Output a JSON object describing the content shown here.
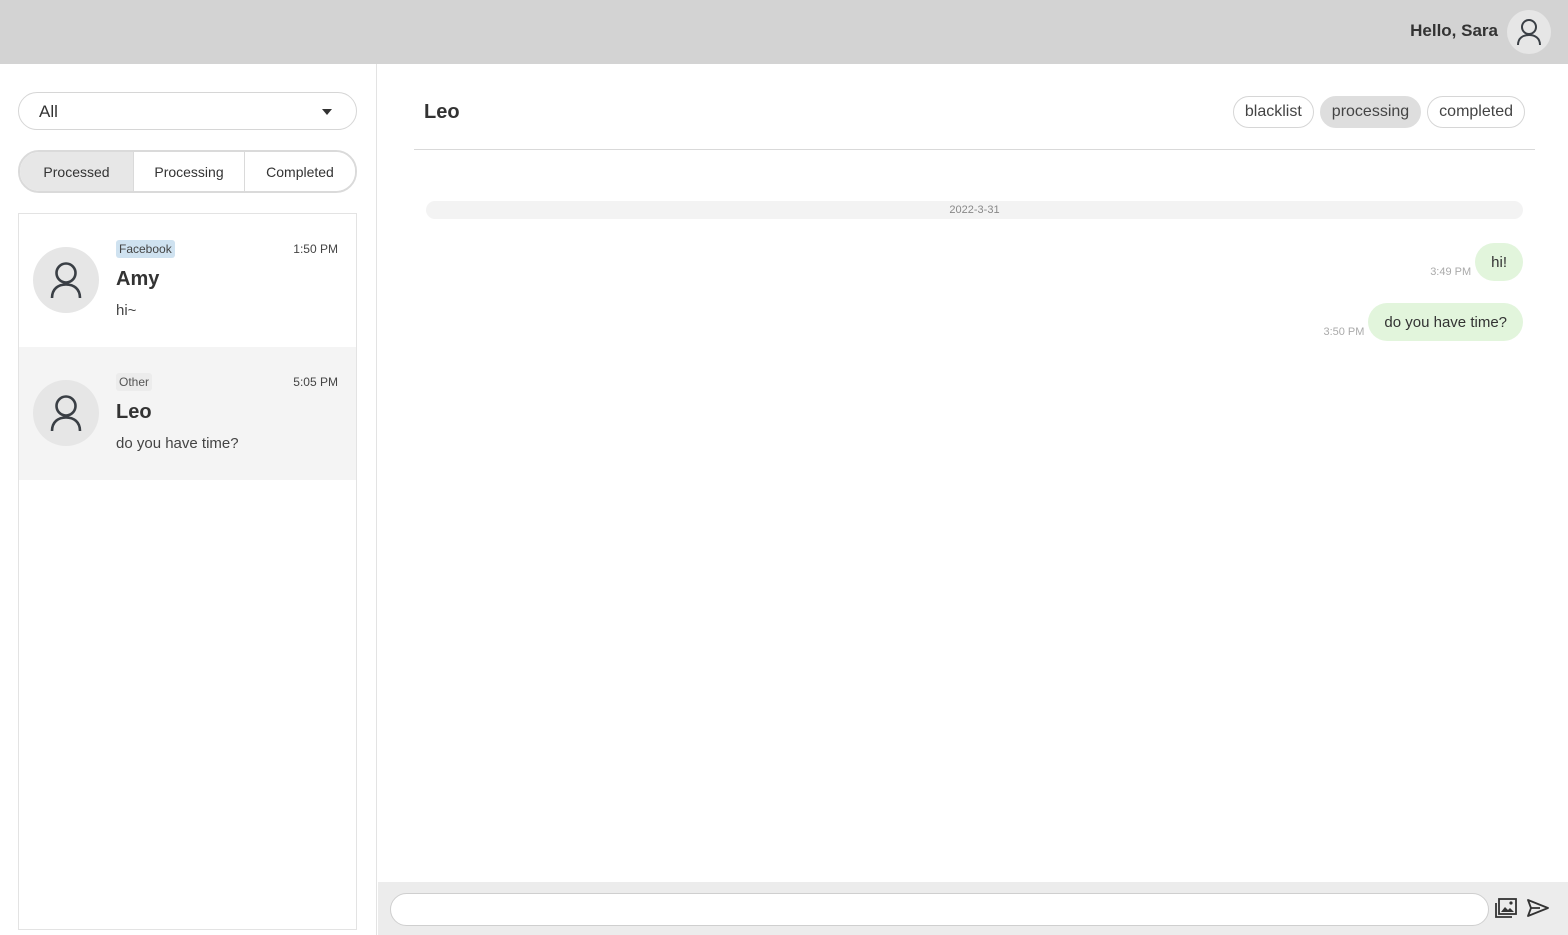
{
  "header": {
    "greeting": "Hello, Sara",
    "avatar_icon": "user-icon"
  },
  "sidebar": {
    "filter": {
      "selected": "All",
      "icon": "chevron-down-icon"
    },
    "tabs": [
      {
        "label": "Processed",
        "active": true
      },
      {
        "label": "Processing",
        "active": false
      },
      {
        "label": "Completed",
        "active": false
      }
    ],
    "conversations": [
      {
        "source": "Facebook",
        "time": "1:50 PM",
        "name": "Amy",
        "preview": "hi~",
        "selected": false
      },
      {
        "source": "Other",
        "time": "5:05 PM",
        "name": "Leo",
        "preview": "do you have time?",
        "selected": true
      }
    ]
  },
  "chat": {
    "title": "Leo",
    "status_buttons": [
      {
        "label": "blacklist",
        "active": false
      },
      {
        "label": "processing",
        "active": true
      },
      {
        "label": "completed",
        "active": false
      }
    ],
    "date_separator": "2022-3-31",
    "messages": [
      {
        "time": "3:49 PM",
        "text": "hi!"
      },
      {
        "time": "3:50 PM",
        "text": "do you have time?"
      }
    ],
    "composer": {
      "placeholder": "",
      "image_icon": "image-icon",
      "send_icon": "send-icon"
    }
  },
  "colors": {
    "topbar": "#d3d3d3",
    "bubble": "#e2f5dc",
    "facebook_tag": "#cfe2f0",
    "selected_row": "#f4f4f4"
  }
}
